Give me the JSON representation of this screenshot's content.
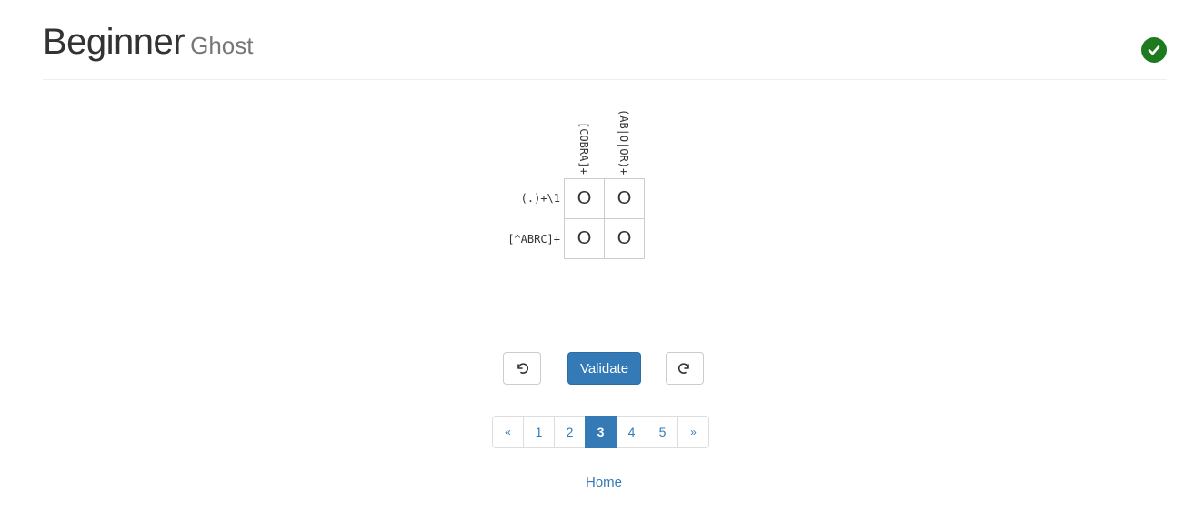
{
  "header": {
    "title": "Beginner",
    "subtitle": "Ghost",
    "status_icon": "check-circle-icon",
    "status_color": "#1e7a1e"
  },
  "puzzle": {
    "column_clues": [
      "[COBRA]+",
      "(AB|O|OR)+"
    ],
    "row_clues": [
      "(.)+\\1",
      "[^ABRC]+"
    ],
    "cells": [
      [
        "O",
        "O"
      ],
      [
        "O",
        "O"
      ]
    ]
  },
  "controls": {
    "undo_icon": "undo-icon",
    "validate_label": "Validate",
    "redo_icon": "redo-icon"
  },
  "pagination": {
    "prev_label": "«",
    "pages": [
      "1",
      "2",
      "3",
      "4",
      "5"
    ],
    "active_page": "3",
    "next_label": "»"
  },
  "footer": {
    "home_label": "Home"
  },
  "colors": {
    "accent": "#337ab7",
    "success": "#1e7a1e"
  }
}
